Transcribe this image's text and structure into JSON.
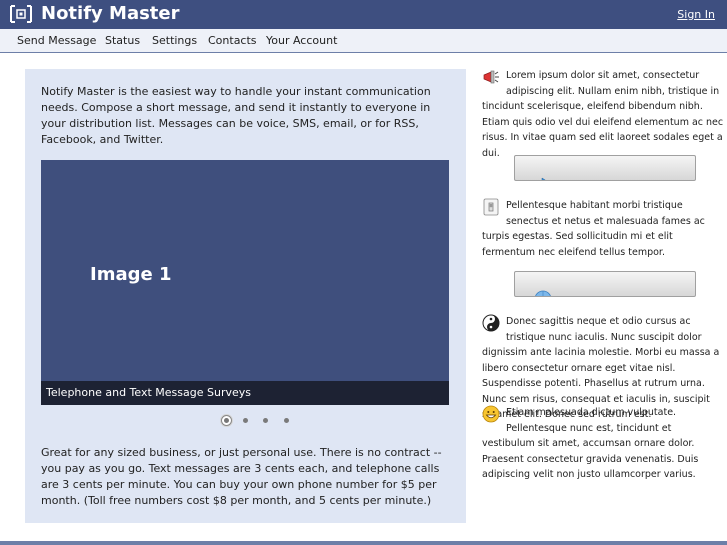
{
  "header": {
    "title": "Notify Master",
    "signin_label": "Sign In",
    "logo_icon": "bracket-logo-icon"
  },
  "nav": {
    "items": [
      {
        "label": "Send Message"
      },
      {
        "label": "Status"
      },
      {
        "label": "Settings"
      },
      {
        "label": "Contacts"
      },
      {
        "label": "Your Account"
      }
    ]
  },
  "main": {
    "intro": "Notify Master is the easiest way to handle your instant communication needs. Compose a short message, and send it instantly to everyone in your distribution list. Messages can be voice, SMS, email, or for RSS, Facebook, and Twitter.",
    "slideshow": {
      "slide_title": "Image 1",
      "caption": "Telephone and Text Message Surveys",
      "dot_count": 4,
      "active_dot": 1
    },
    "outro": "Great for any sized business, or just personal use. There is no contract -- you pay as you go. Text messages are 3 cents each, and telephone calls are 3 cents per minute. You can buy your own phone number for $5 per month. (Toll free numbers cost $8 per month, and 5 cents per minute.)"
  },
  "sidebar": {
    "blocks": [
      {
        "icon": "megaphone-icon",
        "text": "Lorem ipsum dolor sit amet, consectetur adipiscing elit. Nullam enim nibh, tristique in tincidunt scelerisque, eleifend bibendum nibh. Etiam quis odio vel dui eleifend elementum ac nec risus. In vitae quam sed elit laoreet sodales eget a dui."
      },
      {
        "icon": "light-switch-icon",
        "text": "Pellentesque habitant morbi tristique senectus et netus et malesuada fames ac turpis egestas. Sed sollicitudin mi et elit fermentum nec eleifend tellus tempor."
      },
      {
        "icon": "yin-yang-icon",
        "text": "Donec sagittis neque et odio cursus ac tristique nunc iaculis. Nunc suscipit dolor dignissim ante lacinia molestie. Morbi eu massa a libero consectetur ornare eget vitae nisl. Suspendisse potenti. Phasellus at rutrum urna. Nunc sem risus, consequat et iaculis in, suscipit sit amet elit. Donec sed rutrum est."
      },
      {
        "icon": "smiley-icon",
        "text": "Etiam malesuada dictum vulputate. Pellentesque nunc est, tincidunt et vestibulum sit amet, accumsan ornare dolor. Praesent consectetur gravida venenatis. Duis adipiscing velit non justo ullamcorper varius."
      }
    ],
    "buttons": [
      {
        "icon": "cursor-arrow-icon"
      },
      {
        "icon": "globe-icon"
      }
    ]
  }
}
